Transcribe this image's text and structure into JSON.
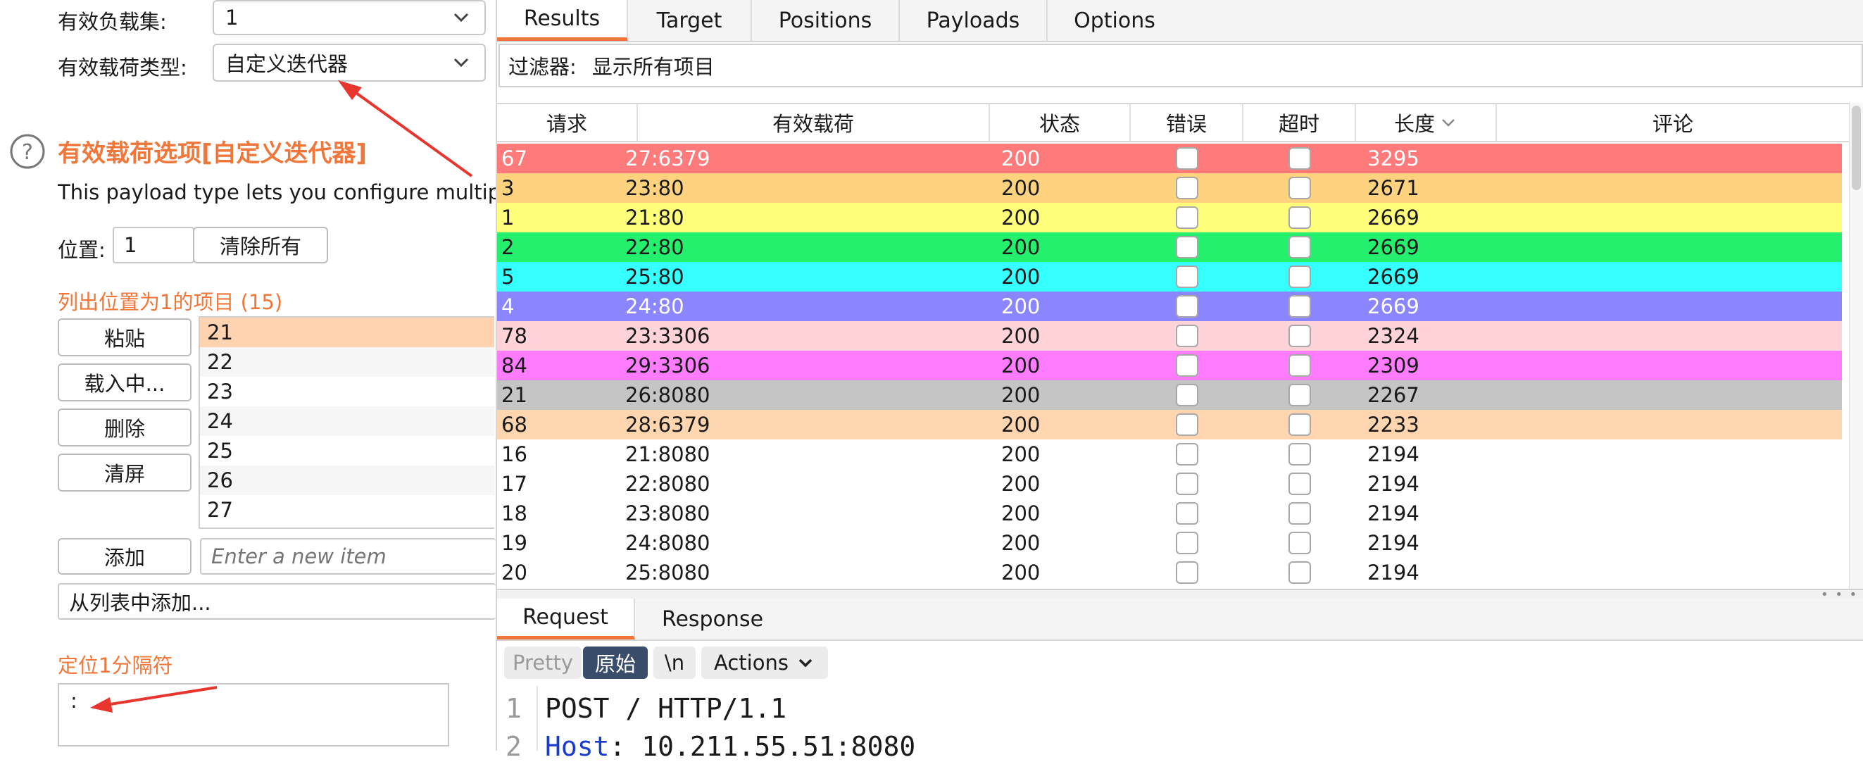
{
  "left": {
    "payload_set_label": "有效负载集:",
    "payload_set_value": "1",
    "payload_type_label": "有效载荷类型:",
    "payload_type_value": "自定义迭代器",
    "section_title": "有效载荷选项[自定义迭代器]",
    "description": "This payload type lets you configure multiple",
    "position_label": "位置:",
    "position_value": "1",
    "clear_all": "清除所有",
    "list_header": "列出位置为1的项目 (15)",
    "buttons": {
      "paste": "粘贴",
      "load": "载入中...",
      "remove": "删除",
      "clear": "清屏",
      "add": "添加"
    },
    "items": [
      "21",
      "22",
      "23",
      "24",
      "25",
      "26",
      "27"
    ],
    "new_item_placeholder": "Enter a new item",
    "add_from_list": "从列表中添加...",
    "separator_title": "定位1分隔符",
    "separator_value": ":"
  },
  "tabs": [
    "Results",
    "Target",
    "Positions",
    "Payloads",
    "Options"
  ],
  "filter_label": "过滤器:",
  "filter_value": "显示所有项目",
  "table": {
    "headers": [
      "请求",
      "有效载荷",
      "状态",
      "错误",
      "超时",
      "长度",
      "评论"
    ],
    "rows": [
      {
        "req": "67",
        "payload": "27:6379",
        "status": "200",
        "len": "3295",
        "color": "#ff7b7b",
        "light": true
      },
      {
        "req": "3",
        "payload": "23:80",
        "status": "200",
        "len": "2671",
        "color": "#ffd27f",
        "light": false
      },
      {
        "req": "1",
        "payload": "21:80",
        "status": "200",
        "len": "2669",
        "color": "#ffff7b",
        "light": false
      },
      {
        "req": "2",
        "payload": "22:80",
        "status": "200",
        "len": "2669",
        "color": "#24f06e",
        "light": false
      },
      {
        "req": "5",
        "payload": "25:80",
        "status": "200",
        "len": "2669",
        "color": "#35ffff",
        "light": false
      },
      {
        "req": "4",
        "payload": "24:80",
        "status": "200",
        "len": "2669",
        "color": "#8b86ff",
        "light": true
      },
      {
        "req": "78",
        "payload": "23:3306",
        "status": "200",
        "len": "2324",
        "color": "#ffd3d8",
        "light": false
      },
      {
        "req": "84",
        "payload": "29:3306",
        "status": "200",
        "len": "2309",
        "color": "#ff7bff",
        "light": false
      },
      {
        "req": "21",
        "payload": "26:8080",
        "status": "200",
        "len": "2267",
        "color": "#c5c5c5",
        "light": false
      },
      {
        "req": "68",
        "payload": "28:6379",
        "status": "200",
        "len": "2233",
        "color": "#ffd6b0",
        "light": false
      },
      {
        "req": "16",
        "payload": "21:8080",
        "status": "200",
        "len": "2194",
        "color": "#ffffff",
        "light": false
      },
      {
        "req": "17",
        "payload": "22:8080",
        "status": "200",
        "len": "2194",
        "color": "#ffffff",
        "light": false
      },
      {
        "req": "18",
        "payload": "23:8080",
        "status": "200",
        "len": "2194",
        "color": "#ffffff",
        "light": false
      },
      {
        "req": "19",
        "payload": "24:8080",
        "status": "200",
        "len": "2194",
        "color": "#ffffff",
        "light": false
      },
      {
        "req": "20",
        "payload": "25:8080",
        "status": "200",
        "len": "2194",
        "color": "#ffffff",
        "light": false
      }
    ]
  },
  "bottom_tabs": [
    "Request",
    "Response"
  ],
  "toolbar": {
    "pretty": "Pretty",
    "raw": "原始",
    "newline": "\\n",
    "actions": "Actions"
  },
  "editor": {
    "line1_no": "1",
    "line1": "POST / HTTP/1.1",
    "line2_no": "2",
    "line2_key": "Host",
    "line2_val": ": 10.211.55.51:8080"
  },
  "colors": {
    "accent": "#f0763a",
    "arrow": "#e8352e"
  }
}
